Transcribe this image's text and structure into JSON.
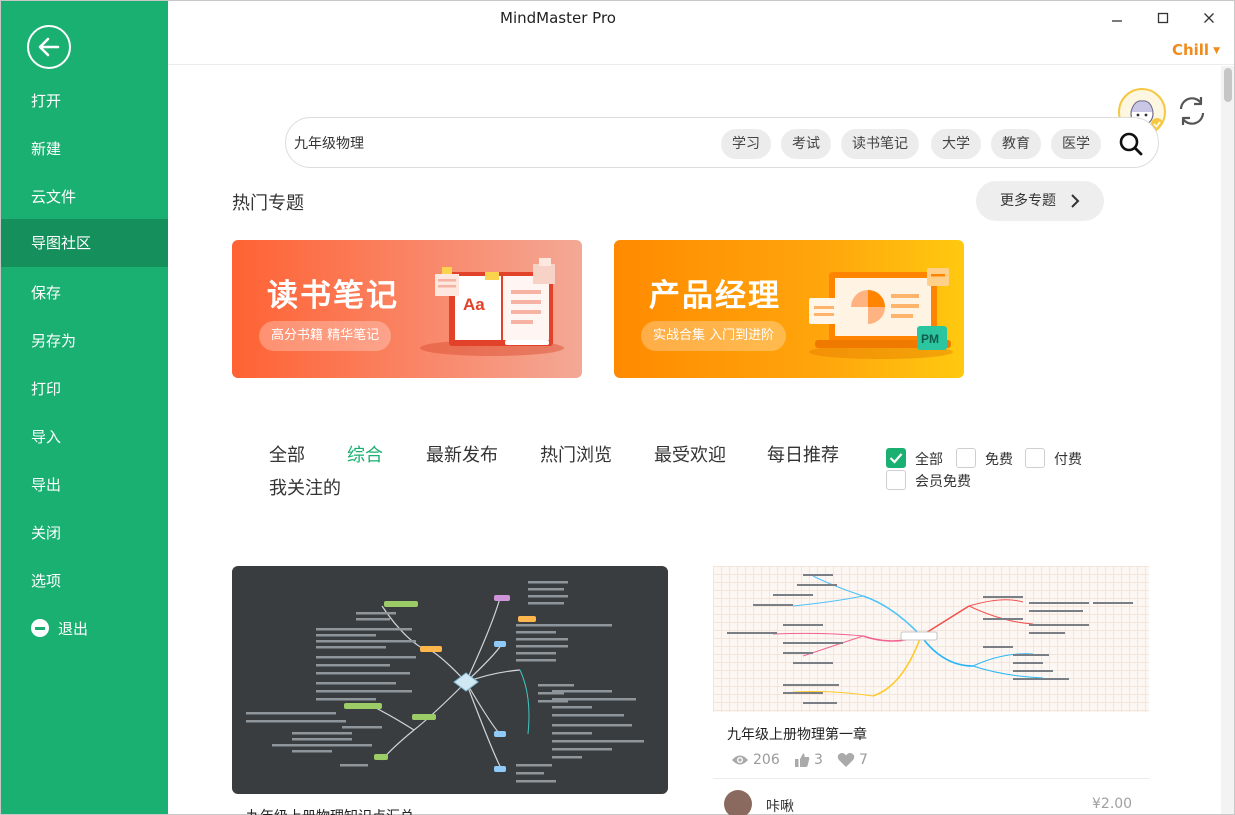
{
  "app": {
    "title": "MindMaster Pro",
    "user": "Chill"
  },
  "sidebar": {
    "items": [
      {
        "label": "打开"
      },
      {
        "label": "新建"
      },
      {
        "label": "云文件"
      },
      {
        "label": "导图社区",
        "active": true
      },
      {
        "label": "保存"
      },
      {
        "label": "另存为"
      },
      {
        "label": "打印"
      },
      {
        "label": "导入"
      },
      {
        "label": "导出"
      },
      {
        "label": "关闭"
      },
      {
        "label": "选项"
      },
      {
        "label": "退出"
      }
    ]
  },
  "search": {
    "value": "九年级物理",
    "tags": [
      "学习",
      "考试",
      "读书笔记",
      "大学",
      "教育",
      "医学"
    ]
  },
  "hot_topics": {
    "title": "热门专题",
    "more_label": "更多专题",
    "banners": [
      {
        "title": "读书笔记",
        "subtitle": "高分书籍 精华笔记"
      },
      {
        "title": "产品经理",
        "subtitle": "实战合集 入门到进阶",
        "badge": "PM"
      }
    ]
  },
  "filters": {
    "tabs": [
      "全部",
      "综合",
      "最新发布",
      "热门浏览",
      "最受欢迎",
      "每日推荐",
      "我关注的"
    ],
    "active_tab": "综合",
    "price_options": [
      {
        "label": "全部",
        "checked": true
      },
      {
        "label": "免费",
        "checked": false
      },
      {
        "label": "付费",
        "checked": false
      },
      {
        "label": "会员免费",
        "checked": false
      }
    ]
  },
  "cards": [
    {
      "title": "九年级上册物理知识点汇总"
    },
    {
      "title": "九年级上册物理第一章",
      "views": "206",
      "likes": "3",
      "favorites": "7",
      "author": "咔啾",
      "price": "¥2.00"
    }
  ],
  "colors": {
    "accent": "#1ab071",
    "accent_dark": "#158f5c",
    "user_name": "#f08c1e"
  }
}
